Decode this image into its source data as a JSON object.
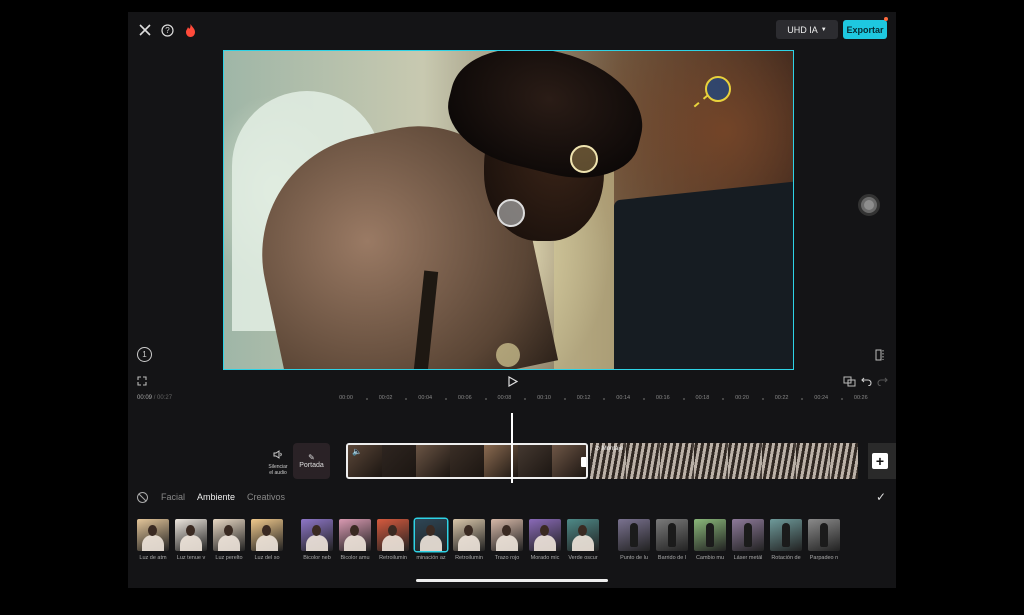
{
  "topbar": {
    "close_icon": "close-icon",
    "help_icon": "help-icon",
    "fire_icon": "fire-icon",
    "uhd_label": "UHD IA",
    "export_label": "Exportar"
  },
  "colors": {
    "accent": "#1ec8e0",
    "selection_border": "#2ed3e6",
    "handle_yellow": "#e8d23c"
  },
  "timeline": {
    "current_time": "00:09",
    "total_time": "00:27",
    "ruler": [
      "00:00",
      "00:02",
      "00:04",
      "00:06",
      "00:08",
      "00:10",
      "00:12",
      "00:14",
      "00:16",
      "00:18",
      "00:20",
      "00:22",
      "00:24",
      "00:26"
    ],
    "audio_label_1": "Silenciar",
    "audio_label_2": "el audio",
    "cover_label": "Portada",
    "montage_label": "Montaje"
  },
  "tabs": [
    "Facial",
    "Ambiente",
    "Creativos"
  ],
  "active_tab": "Ambiente",
  "filters": [
    {
      "label": "Luz de atm",
      "kind": "portrait",
      "bg": "#e4c69a"
    },
    {
      "label": "Luz tenue v",
      "kind": "portrait",
      "bg": "#ece6de"
    },
    {
      "label": "Luz perelto",
      "kind": "portrait",
      "bg": "#e8d8c4"
    },
    {
      "label": "Luz del so",
      "kind": "portrait",
      "bg": "#f0c98c"
    },
    {
      "label": "Bicolor neb",
      "kind": "portrait",
      "bg": "#8e76c8"
    },
    {
      "label": "Bicolor amu",
      "kind": "portrait",
      "bg": "#d99ab2"
    },
    {
      "label": "Retroilumin",
      "kind": "portrait",
      "bg": "#d65a3e"
    },
    {
      "label": "minación az",
      "kind": "portrait",
      "bg": "#2d4656",
      "selected": true
    },
    {
      "label": "Retroilumin",
      "kind": "portrait",
      "bg": "#d8c6aa"
    },
    {
      "label": "Trazo rojo",
      "kind": "portrait",
      "bg": "#d6b8a8"
    },
    {
      "label": "Morado mic",
      "kind": "portrait",
      "bg": "#8a6ab8"
    },
    {
      "label": "Verde oscur",
      "kind": "portrait",
      "bg": "#4e8a88"
    },
    {
      "label": "Punto de lu",
      "kind": "dancer",
      "bg": "#7a7290"
    },
    {
      "label": "Barrido de l",
      "kind": "dancer",
      "bg": "#7a7a7a"
    },
    {
      "label": "Cambio mu",
      "kind": "dancer",
      "bg": "#8ab87a"
    },
    {
      "label": "Láser metál",
      "kind": "dancer",
      "bg": "#8e7a9a"
    },
    {
      "label": "Rotación de",
      "kind": "dancer",
      "bg": "#6e9a9a"
    },
    {
      "label": "Parpadeo n",
      "kind": "dancer",
      "bg": "#8a8a8a"
    }
  ]
}
